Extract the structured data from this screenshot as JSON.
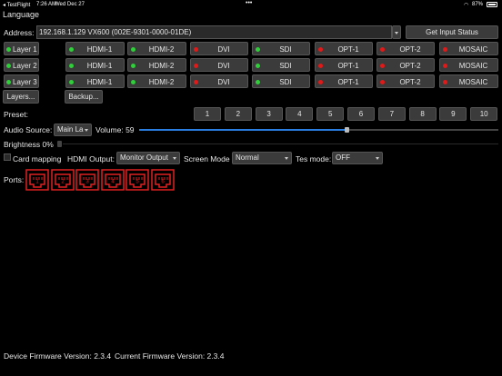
{
  "status_bar": {
    "app": "◂ TestFlight",
    "time": "7:26 AM",
    "date": "Wed Dec 27",
    "dots": "•••",
    "battery": "87%"
  },
  "menu": {
    "language": "Language"
  },
  "address": {
    "label": "Address:",
    "value": "192.168.1.129 VX600 (002E-9301-0000-01DE)",
    "get_status_label": "Get Input Status"
  },
  "layers": [
    {
      "label": "Layer 1",
      "sources": [
        {
          "label": "HDMI-1",
          "status": "green"
        },
        {
          "label": "HDMI-2",
          "status": "green"
        },
        {
          "label": "DVI",
          "status": "red"
        },
        {
          "label": "SDI",
          "status": "green"
        },
        {
          "label": "OPT-1",
          "status": "red"
        },
        {
          "label": "OPT-2",
          "status": "red"
        },
        {
          "label": "MOSAIC",
          "status": "red"
        }
      ]
    },
    {
      "label": "Layer 2",
      "sources": [
        {
          "label": "HDMI-1",
          "status": "green"
        },
        {
          "label": "HDMI-2",
          "status": "green"
        },
        {
          "label": "DVI",
          "status": "red"
        },
        {
          "label": "SDI",
          "status": "green"
        },
        {
          "label": "OPT-1",
          "status": "red"
        },
        {
          "label": "OPT-2",
          "status": "red"
        },
        {
          "label": "MOSAIC",
          "status": "red"
        }
      ]
    },
    {
      "label": "Layer 3",
      "sources": [
        {
          "label": "HDMI-1",
          "status": "green"
        },
        {
          "label": "HDMI-2",
          "status": "green"
        },
        {
          "label": "DVI",
          "status": "red"
        },
        {
          "label": "SDI",
          "status": "green"
        },
        {
          "label": "OPT-1",
          "status": "red"
        },
        {
          "label": "OPT-2",
          "status": "red"
        },
        {
          "label": "MOSAIC",
          "status": "red"
        }
      ]
    }
  ],
  "actions": {
    "layers_label": "Layers...",
    "backup_label": "Backup..."
  },
  "preset": {
    "label": "Preset:",
    "buttons": [
      "1",
      "2",
      "3",
      "4",
      "5",
      "6",
      "7",
      "8",
      "9",
      "10"
    ]
  },
  "audio": {
    "label": "Audio Source:",
    "source_value": "Main La",
    "volume_label": "Volume: 59",
    "volume_fraction": 0.59
  },
  "brightness": {
    "label": "Brightness 0%",
    "fraction": 0.0
  },
  "settings": {
    "card_mapping_label": "Card mapping",
    "hdmi_output_label": "HDMI Output:",
    "hdmi_output_value": "Monitor Output",
    "screen_mode_label": "Screen Mode",
    "screen_mode_value": "Normal",
    "tes_mode_label": "Tes mode:",
    "tes_mode_value": "OFF"
  },
  "ports": {
    "label": "Ports:",
    "numbers": [
      "1",
      "2",
      "3",
      "4",
      "5",
      "6"
    ]
  },
  "firmware": {
    "device": "Device Firmware Version: 2.3.4",
    "current": "Current Firmware Version: 2.3.4"
  },
  "colors": {
    "ok": "#2fcf3a",
    "error": "#e01919",
    "port": "#e02020",
    "accent": "#2a7de1"
  }
}
